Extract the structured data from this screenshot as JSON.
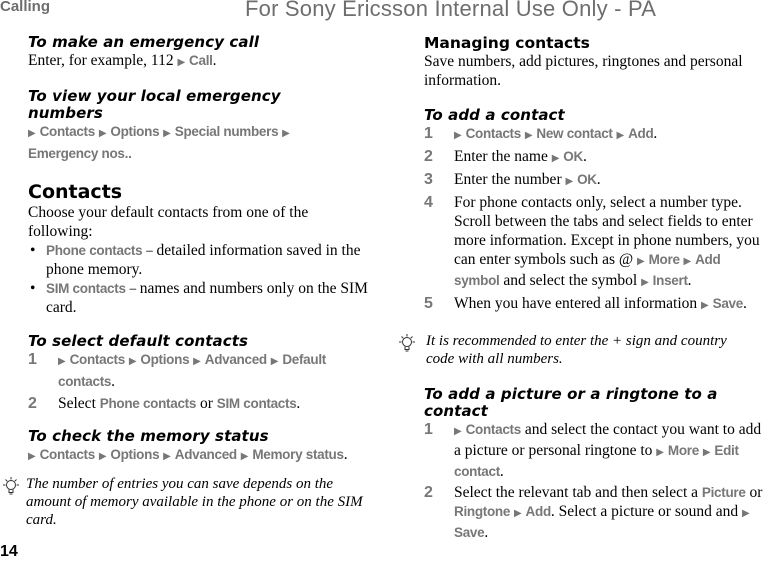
{
  "header": {
    "section": "Calling",
    "watermark": "For Sony Ericsson Internal Use Only - PA"
  },
  "page_number": "14",
  "left": {
    "emergency_call": {
      "title": "To make an emergency call",
      "text_pre": "Enter, for example, 112",
      "action": "Call",
      "text_post": "."
    },
    "view_emergency": {
      "title": "To view your local emergency numbers",
      "path": [
        "Contacts",
        "Options",
        "Special numbers",
        "Emergency nos."
      ],
      "text_post": "."
    },
    "contacts": {
      "title": "Contacts",
      "intro": "Choose your default contacts from one of the following:",
      "bullets": [
        {
          "term": "Phone contacts",
          "sep": " – ",
          "desc": "detailed information saved in the phone memory."
        },
        {
          "term": "SIM contacts",
          "sep": " – ",
          "desc": "names and numbers only on the SIM card."
        }
      ]
    },
    "select_default": {
      "title": "To select default contacts",
      "steps": [
        {
          "num": "1",
          "path": [
            "Contacts",
            "Options",
            "Advanced",
            "Default contacts"
          ],
          "post": "."
        },
        {
          "num": "2",
          "pre": "Select ",
          "opt1": "Phone contacts",
          "mid": " or ",
          "opt2": "SIM contacts",
          "post": "."
        }
      ]
    },
    "memory_status": {
      "title": "To check the memory status",
      "path": [
        "Contacts",
        "Options",
        "Advanced",
        "Memory status"
      ],
      "post": "."
    },
    "tip": "The number of entries you can save depends on the amount of memory available in the phone or on the SIM card."
  },
  "right": {
    "managing": {
      "title": "Managing contacts",
      "intro": "Save numbers, add pictures, ringtones and personal information."
    },
    "add_contact": {
      "title": "To add a contact",
      "steps": [
        {
          "num": "1",
          "path": [
            "Contacts",
            "New contact",
            "Add"
          ],
          "post": "."
        },
        {
          "num": "2",
          "pre": "Enter the name",
          "action": "OK",
          "post": "."
        },
        {
          "num": "3",
          "pre": "Enter the number",
          "action": "OK",
          "post": "."
        },
        {
          "num": "4",
          "pre": "For phone contacts only, select a number type. Scroll between the tabs and select fields to enter more information. Except in phone numbers, you can enter symbols such as @",
          "a1": "More",
          "a2": "Add symbol",
          "mid": " and select the symbol",
          "a3": "Insert",
          "post": "."
        },
        {
          "num": "5",
          "pre": "When you have entered all information",
          "action": "Save",
          "post": "."
        }
      ]
    },
    "tip": "It is recommended to enter the + sign and country code with all numbers.",
    "add_picture": {
      "title": "To add a picture or a ringtone to a contact",
      "steps": [
        {
          "num": "1",
          "a1": "Contacts",
          "t1": " and select the contact you want to add a picture or personal ringtone to",
          "a2": "More",
          "a3": "Edit contact",
          "post": "."
        },
        {
          "num": "2",
          "t1": "Select the relevant tab and then select a ",
          "a1": "Picture",
          "t2": " or ",
          "a2": "Ringtone",
          "a3": "Add",
          "t3": ". Select a picture or sound and",
          "a4": "Save",
          "post": "."
        }
      ]
    }
  },
  "icons": {
    "arrow": "▶",
    "bullet": "•"
  }
}
